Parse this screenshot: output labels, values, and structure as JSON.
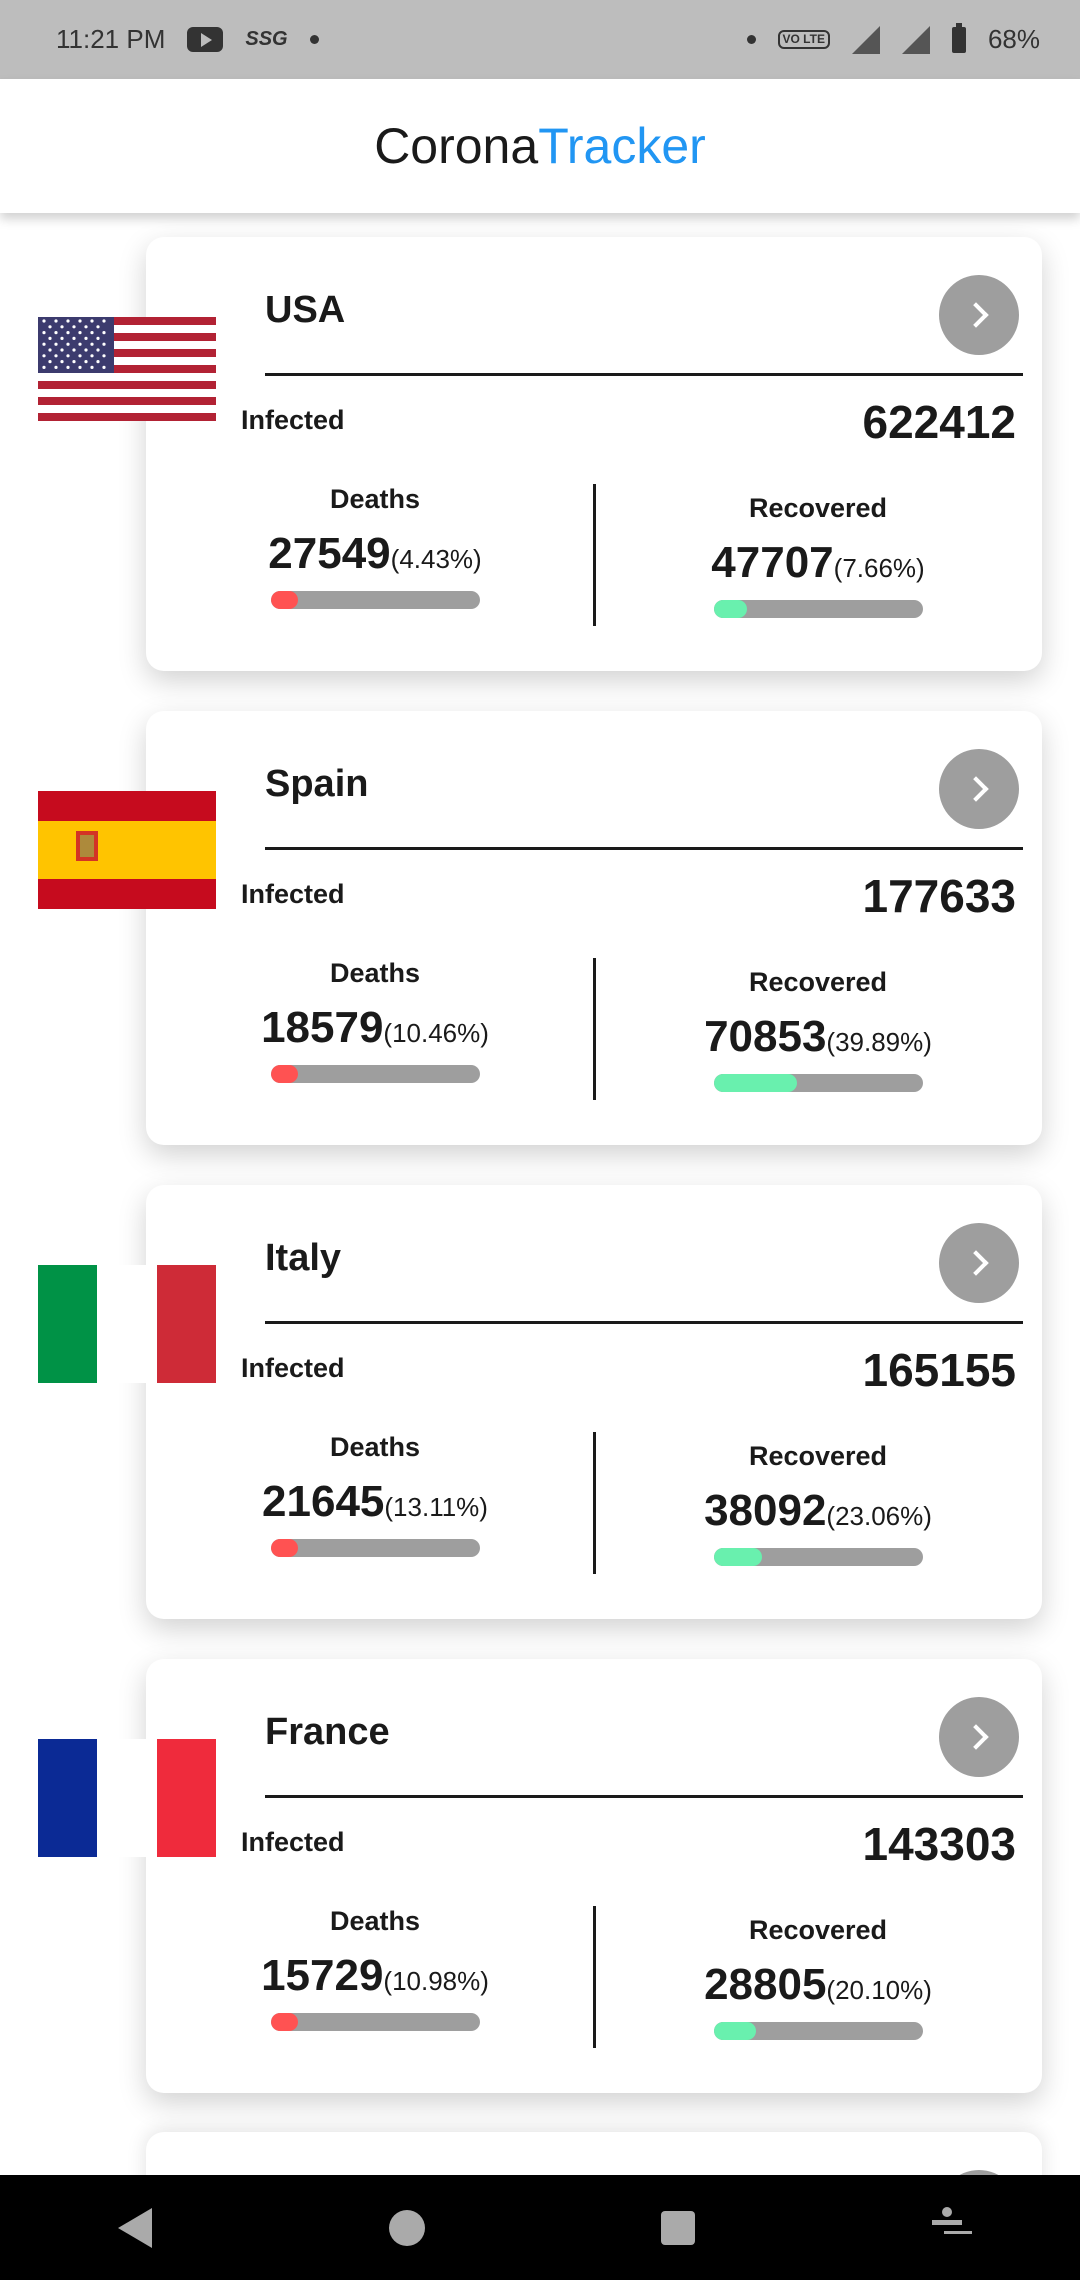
{
  "status_bar": {
    "time": "11:21 PM",
    "carrier_badge": "SSG",
    "volte": "VO LTE",
    "battery": "68%",
    "icons": [
      "youtube-icon",
      "ssg-icon",
      "dot-icon",
      "volte-icon",
      "signal-icon",
      "battery-icon"
    ]
  },
  "app_bar": {
    "brand_part1": "Corona",
    "brand_part2": "Tracker",
    "brand_part2_color": "#2196f3"
  },
  "colors": {
    "death_bar": "#ff5252",
    "recovered_bar": "#69f0ae",
    "track": "#9e9e9e"
  },
  "countries": [
    {
      "name": "USA",
      "flag": "usa",
      "infected_label": "Infected",
      "infected": "622412",
      "deaths_label": "Deaths",
      "deaths": "27549",
      "deaths_pct": "(4.43%)",
      "deaths_frac": 0.0443,
      "recovered_label": "Recovered",
      "recovered": "47707",
      "recovered_pct": "(7.66%)",
      "recovered_frac": 0.0766
    },
    {
      "name": "Spain",
      "flag": "spain",
      "infected_label": "Infected",
      "infected": "177633",
      "deaths_label": "Deaths",
      "deaths": "18579",
      "deaths_pct": "(10.46%)",
      "deaths_frac": 0.1046,
      "recovered_label": "Recovered",
      "recovered": "70853",
      "recovered_pct": "(39.89%)",
      "recovered_frac": 0.3989
    },
    {
      "name": "Italy",
      "flag": "italy",
      "infected_label": "Infected",
      "infected": "165155",
      "deaths_label": "Deaths",
      "deaths": "21645",
      "deaths_pct": "(13.11%)",
      "deaths_frac": 0.1311,
      "recovered_label": "Recovered",
      "recovered": "38092",
      "recovered_pct": "(23.06%)",
      "recovered_frac": 0.2306
    },
    {
      "name": "France",
      "flag": "france",
      "infected_label": "Infected",
      "infected": "143303",
      "deaths_label": "Deaths",
      "deaths": "15729",
      "deaths_pct": "(10.98%)",
      "deaths_frac": 0.1098,
      "recovered_label": "Recovered",
      "recovered": "28805",
      "recovered_pct": "(20.10%)",
      "recovered_frac": 0.201
    }
  ],
  "nav_bar": {
    "icons": [
      "back-icon",
      "home-icon",
      "recents-icon",
      "accessibility-icon"
    ]
  }
}
